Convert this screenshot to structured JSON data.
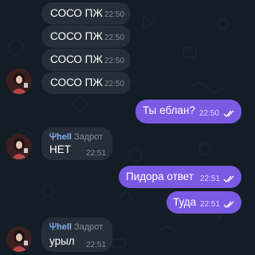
{
  "theme": {
    "background": "#141d25",
    "incoming_bubble": "#262f39",
    "outgoing_bubble": "#7b5ae3",
    "sender_name": "#7fb0ea"
  },
  "messages": [
    {
      "direction": "in",
      "text": "СОСО ПЖ",
      "time": "22:50"
    },
    {
      "direction": "in",
      "text": "СОСО ПЖ",
      "time": "22:50"
    },
    {
      "direction": "in",
      "text": "СОСО ПЖ",
      "time": "22:50"
    },
    {
      "direction": "in",
      "text": "СОСО ПЖ",
      "time": "22:50"
    },
    {
      "direction": "out",
      "text": "Ты еблан?",
      "time": "22:50",
      "status": "read"
    },
    {
      "direction": "in",
      "sender_name": "hell",
      "sender_rank": "Задрот",
      "text": "НЕТ",
      "time": "22:51"
    },
    {
      "direction": "out",
      "text": "Пидора ответ",
      "time": "22:51",
      "status": "read"
    },
    {
      "direction": "out",
      "text": "Туда",
      "time": "22:51",
      "status": "read"
    },
    {
      "direction": "in",
      "sender_name": "hell",
      "sender_rank": "Задрот",
      "text": "урыл",
      "time": "22:51"
    }
  ],
  "icons": {
    "sender_prefix": "trident-icon",
    "read_status": "double-check-icon",
    "avatar": "user-avatar"
  }
}
